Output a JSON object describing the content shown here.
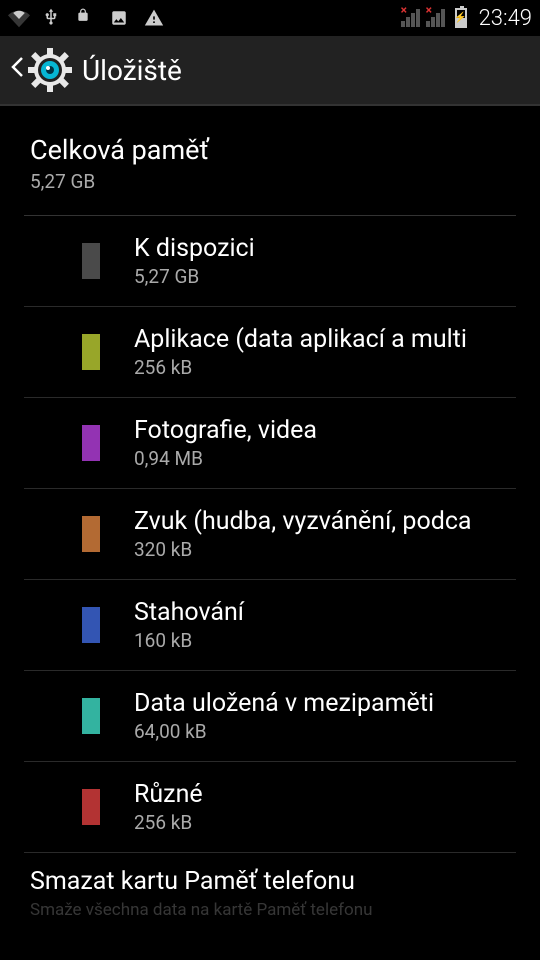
{
  "status": {
    "clock": "23:49"
  },
  "header": {
    "title": "Úložiště"
  },
  "total": {
    "label": "Celková paměť",
    "value": "5,27 GB"
  },
  "items": [
    {
      "color": "#4a4a4a",
      "title": "K dispozici",
      "value": "5,27 GB"
    },
    {
      "color": "#98a629",
      "title": "Aplikace (data aplikací a multi",
      "value": "256 kB"
    },
    {
      "color": "#9333b3",
      "title": "Fotografie, videa",
      "value": "0,94 MB"
    },
    {
      "color": "#b36a33",
      "title": "Zvuk (hudba, vyzvánění, podca",
      "value": "320 kB"
    },
    {
      "color": "#3355b3",
      "title": "Stahování",
      "value": "160 kB"
    },
    {
      "color": "#33b3a0",
      "title": "Data uložená v mezipaměti",
      "value": "64,00 kB"
    },
    {
      "color": "#b33333",
      "title": "Různé",
      "value": "256 kB"
    }
  ],
  "erase": {
    "title": "Smazat kartu Paměť telefonu",
    "subtitle": "Smaže všechna data na kartě Paměť telefonu"
  }
}
